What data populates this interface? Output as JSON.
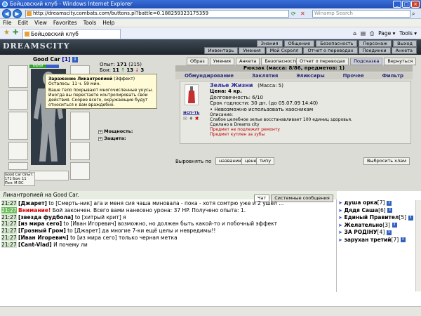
{
  "browser": {
    "window_title": "Бойцовский клуб - Windows Internet Explorer",
    "url": "http://dreamscity.combats.com/buttons.pl?battle=0.188259323175359",
    "search_placeholder": "Winamp Search",
    "menu": [
      "File",
      "Edit",
      "View",
      "Favorites",
      "Tools",
      "Help"
    ],
    "tab_title": "Бойцовский клуб",
    "tools": [
      "Page ▾",
      "Tools ▾"
    ]
  },
  "game": {
    "logo": "DREAMSCITY",
    "topnav1": [
      "Знания",
      "Общение",
      "Безопасность",
      "Персонаж",
      "Выход"
    ],
    "topnav2": [
      "Инвентарь",
      "Умения",
      "Мой Скролл",
      "Отчет о переводах",
      "Поединки",
      "Анкета"
    ],
    "char_name": "Good Car",
    "char_level": "[1]",
    "hp": "69/69",
    "stats": {
      "exp_label": "Опыт:",
      "exp": "171",
      "exp_next": "(215)",
      "wins_label": "Бои:",
      "wins": "11",
      "losses": "13",
      "draws": "3"
    },
    "stat_rows": [
      "Мощность:",
      "Защита:"
    ],
    "tooltip": {
      "title": "Заражение Ликантропией",
      "kind": "(Эффект)",
      "remaining": "Осталось: 11 ч. 59 мин.",
      "text": "Ваше тело покрывают многочисленные укусы. Иногда вы перестаете контролировать свои действия. Скорее всего, окружающие будут относиться к вам враждебно."
    },
    "info_small": "Good Car\nОпыт: 171\nБои: 11\nПол: М\nDC"
  },
  "panel": {
    "top_buttons": [
      "Образ",
      "Умения",
      "Анкета",
      "Безопасность"
    ],
    "top_buttons2": [
      "Отчет о переводах",
      "Подсказка",
      "Вернуться"
    ],
    "backpack_title": "Рюкзак (масса: 8/86, предметов: 1)",
    "categories": [
      "Обмундирование",
      "Заклятия",
      "Эликсиры",
      "Прочее",
      "Фильтр"
    ],
    "item": {
      "name": "Зелье Жизни",
      "mass": "(Масса: 5)",
      "price": "Цена: 4 кр.",
      "durability": "Долговечность: 6/10",
      "expiry": "Срок годности: 30 дн. (до 05.07.09 14:40)",
      "restriction": "• Невозможно использовать хаосникам",
      "desc_label": "Описание:",
      "desc": "Слабое целебное зелье восстанавливает 100 единиц здоровья.",
      "made": "Сделано в Dreams city",
      "warn1": "Предмет не подлежит ремонту",
      "warn2": "Предмет куплен за зубы",
      "use_label": "исп-ть"
    },
    "sort_label": "Выровнять по",
    "sort_buttons": [
      "названию",
      "цене",
      "типу"
    ],
    "sell_button": "Выбросить хлам"
  },
  "chat": {
    "strip_text": "Ликантропией на Good Car.",
    "tabs": [
      "Чат",
      "Системные сообщения"
    ],
    "lines": [
      {
        "time": "21:27",
        "nick": "[Джарет]",
        "text": " to [Смерть-ник] ага и меня сия чаша миновала - пока - хотя сомтрю уже и 2 ушел ..."
      },
      {
        "time": "21:27",
        "nick": "",
        "red": "Внимание!",
        "text": " Бой закончен. Всего вами нанесено урона: 37 HP. Получено опыта: 1."
      },
      {
        "time": "21:27",
        "nick": "[звезда фудбола]",
        "text": " to [хитрый крит] я"
      },
      {
        "time": "21:27",
        "nick": "[из мира сего]",
        "text": " to [Иван Игоревич] возможно, но должен быть какой-то и побочный эффект"
      },
      {
        "time": "21:27",
        "nick": "[Грозный Гром]",
        "text": " to [Джарет] да многие 7-ки ещё целы и невредимы!!"
      },
      {
        "time": "21:27",
        "nick": "[Иван Игоревич]",
        "text": " to [из мира сего] только черная метка"
      },
      {
        "time": "21:27",
        "nick": "[Cant-Vlad]",
        "text": " И почему ли"
      }
    ],
    "users": [
      {
        "name": "душа орка",
        "lvl": "[7]"
      },
      {
        "name": "Дядя Саша",
        "lvl": "[6]"
      },
      {
        "name": "Единый Правител",
        "lvl": "[5]"
      },
      {
        "name": "Желательно",
        "lvl": "[3]"
      },
      {
        "name": "ЗА РОДІНУ",
        "lvl": "[4]"
      },
      {
        "name": "зарухан третий",
        "lvl": "[7]"
      }
    ]
  }
}
